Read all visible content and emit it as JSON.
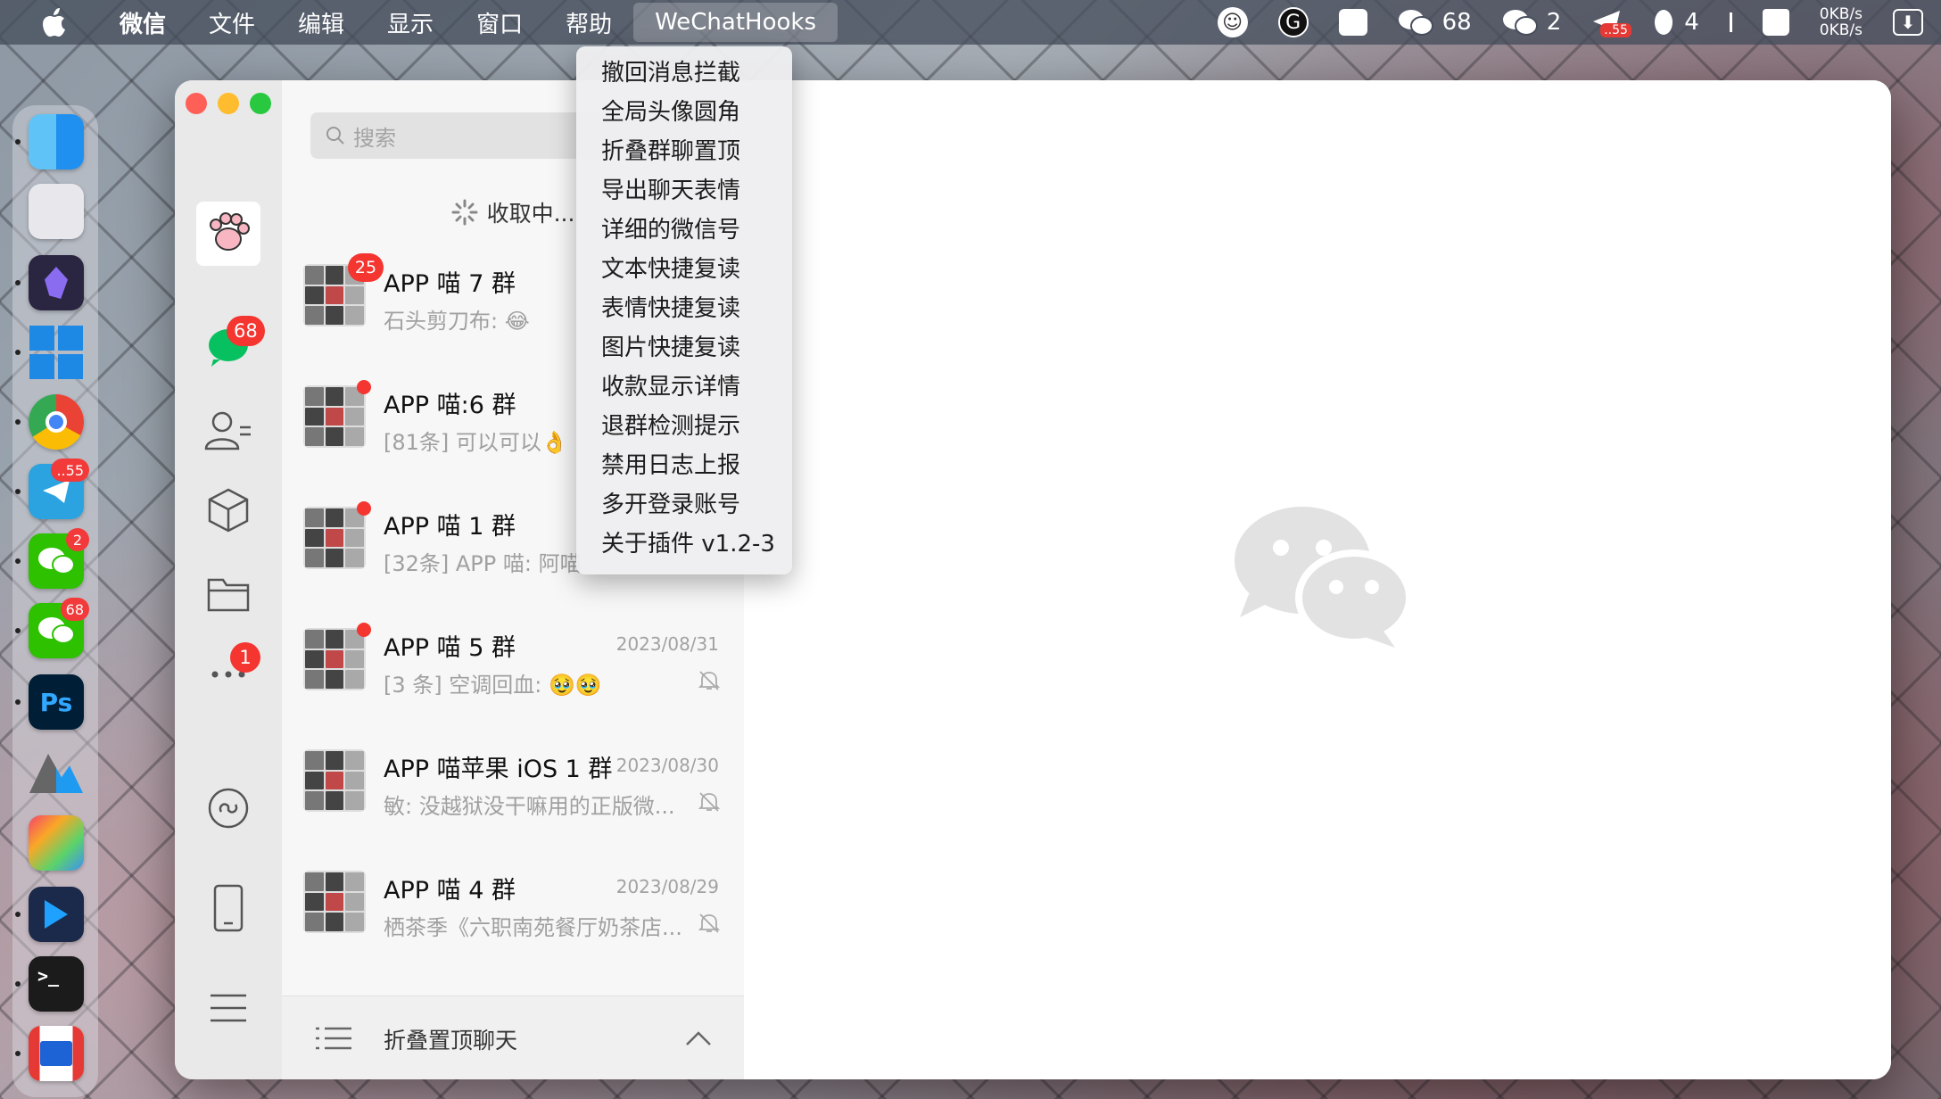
{
  "menubar": {
    "app_name": "微信",
    "items": [
      "文件",
      "编辑",
      "显示",
      "窗口",
      "帮助"
    ],
    "active_menu": "WeChatHooks",
    "status": {
      "wechat_count_1": "68",
      "wechat_count_2": "2",
      "telegram_badge": "..55",
      "qq_count": "4",
      "net_up": "0KB/s",
      "net_down": "0KB/s"
    }
  },
  "dock": {
    "badges": {
      "telegram": "..55",
      "wechat_a": "2",
      "wechat_b": "68"
    },
    "ps_label": "Ps",
    "terminal_label": ">_"
  },
  "sidebar": {
    "chats_badge": "68",
    "more_badge": "1"
  },
  "chatlist": {
    "search_placeholder": "搜索",
    "receiving": "收取中...",
    "chats": [
      {
        "name": "APP 喵 7 群",
        "message": "石头剪刀布: 😂",
        "date": "",
        "badge": "25"
      },
      {
        "name": "APP 喵:6 群",
        "message": "[81条] 可以可以👌",
        "date": ""
      },
      {
        "name": "APP 喵 1 群",
        "message": "[32条] APP 喵:  阿喵",
        "date": ""
      },
      {
        "name": "APP 喵 5 群",
        "message": "[3 条] 空调回血: 🥹🥹",
        "date": "2023/08/31"
      },
      {
        "name": "APP 喵苹果 iOS 1 群",
        "message": "敏: 没越狱没干嘛用的正版微...",
        "date": "2023/08/30"
      },
      {
        "name": "APP 喵 4 群",
        "message": "栖茶季《六职南苑餐厅奶茶店...",
        "date": "2023/08/29"
      }
    ],
    "fold_label": "折叠置顶聊天"
  },
  "dropdown": {
    "items": [
      "撤回消息拦截",
      "全局头像圆角",
      "折叠群聊置顶",
      "导出聊天表情",
      "详细的微信号",
      "文本快捷复读",
      "表情快捷复读",
      "图片快捷复读",
      "收款显示详情",
      "退群检测提示",
      "禁用日志上报",
      "多开登录账号",
      "关于插件 v1.2-3"
    ]
  }
}
